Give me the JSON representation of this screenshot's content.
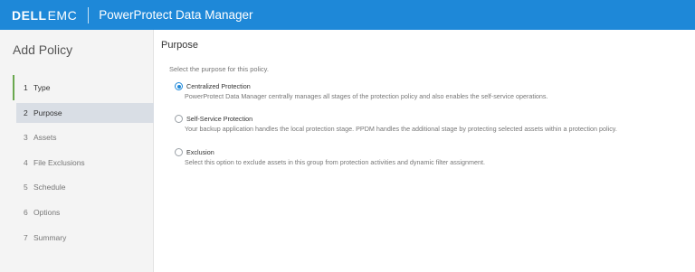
{
  "header": {
    "brand_dell": "DELL",
    "brand_emc": "EMC",
    "app_title": "PowerProtect Data Manager",
    "background_color": "#1e88d8"
  },
  "sidebar": {
    "title": "Add Policy",
    "steps": [
      {
        "number": "1",
        "label": "Type",
        "state": "completed"
      },
      {
        "number": "2",
        "label": "Purpose",
        "state": "active"
      },
      {
        "number": "3",
        "label": "Assets",
        "state": "pending"
      },
      {
        "number": "4",
        "label": "File Exclusions",
        "state": "pending"
      },
      {
        "number": "5",
        "label": "Schedule",
        "state": "pending"
      },
      {
        "number": "6",
        "label": "Options",
        "state": "pending"
      },
      {
        "number": "7",
        "label": "Summary",
        "state": "pending"
      }
    ]
  },
  "main": {
    "section_title": "Purpose",
    "intro": "Select the purpose for this policy.",
    "options": [
      {
        "label": "Centralized Protection",
        "description": "PowerProtect Data Manager centrally manages all stages of the protection policy and also enables the self-service operations.",
        "selected": true
      },
      {
        "label": "Self-Service Protection",
        "description": "Your backup application handles the local protection stage. PPDM handles the additional stage by protecting selected assets within a protection policy.",
        "selected": false
      },
      {
        "label": "Exclusion",
        "description": "Select this option to exclude assets in this group from protection activities and dynamic filter assignment.",
        "selected": false
      }
    ]
  }
}
